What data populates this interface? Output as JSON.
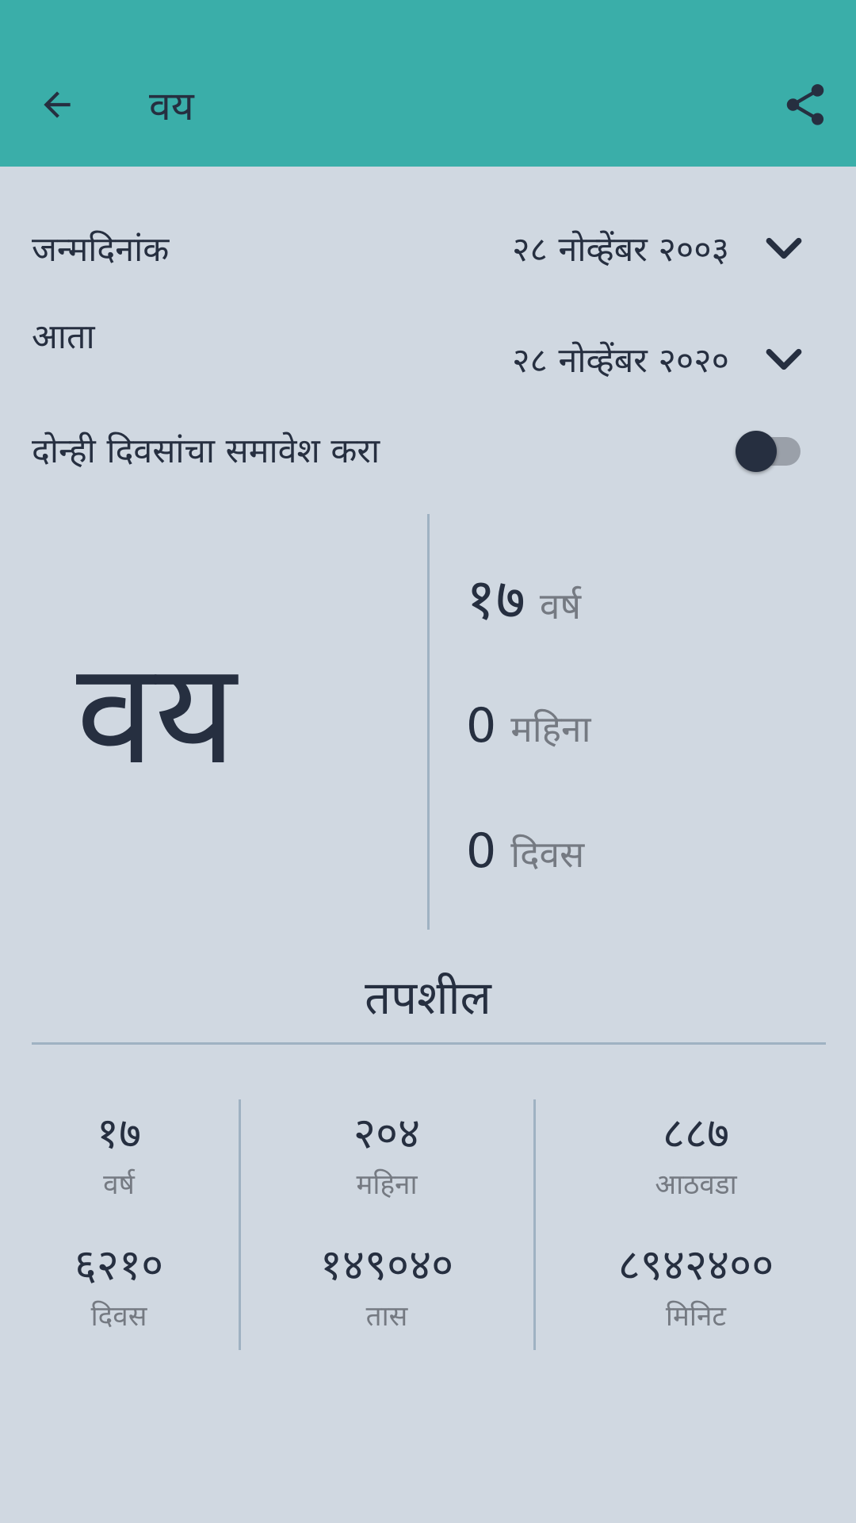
{
  "app_bar": {
    "title": "वय",
    "background": "#3aaea9"
  },
  "birthdate": {
    "label": "जन्मदिनांक",
    "value": "२८ नोव्हेंबर २००३"
  },
  "now": {
    "label": "आता",
    "value": "२८ नोव्हेंबर २०२०"
  },
  "include_both_days": {
    "label": "दोन्ही दिवसांचा समावेश करा",
    "enabled": false
  },
  "age": {
    "heading": "वय",
    "years": {
      "value": "१७",
      "unit": "वर्ष"
    },
    "months": {
      "value": "0",
      "unit": "महिना"
    },
    "days": {
      "value": "0",
      "unit": "दिवस"
    }
  },
  "details": {
    "title": "तपशील",
    "items": [
      {
        "value": "१७",
        "unit": "वर्ष"
      },
      {
        "value": "२०४",
        "unit": "महिना"
      },
      {
        "value": "८८७",
        "unit": "आठवडा"
      },
      {
        "value": "६२१०",
        "unit": "दिवस"
      },
      {
        "value": "१४९०४०",
        "unit": "तास"
      },
      {
        "value": "८९४२४००",
        "unit": "मिनिट"
      }
    ]
  },
  "icons": {
    "back": "arrow-back-icon",
    "share": "share-icon",
    "dropdown": "chevron-down-icon"
  },
  "colors": {
    "background": "#d0d8e1",
    "text": "#262f40",
    "muted_text": "#757a82",
    "divider": "#9fb2c2"
  }
}
